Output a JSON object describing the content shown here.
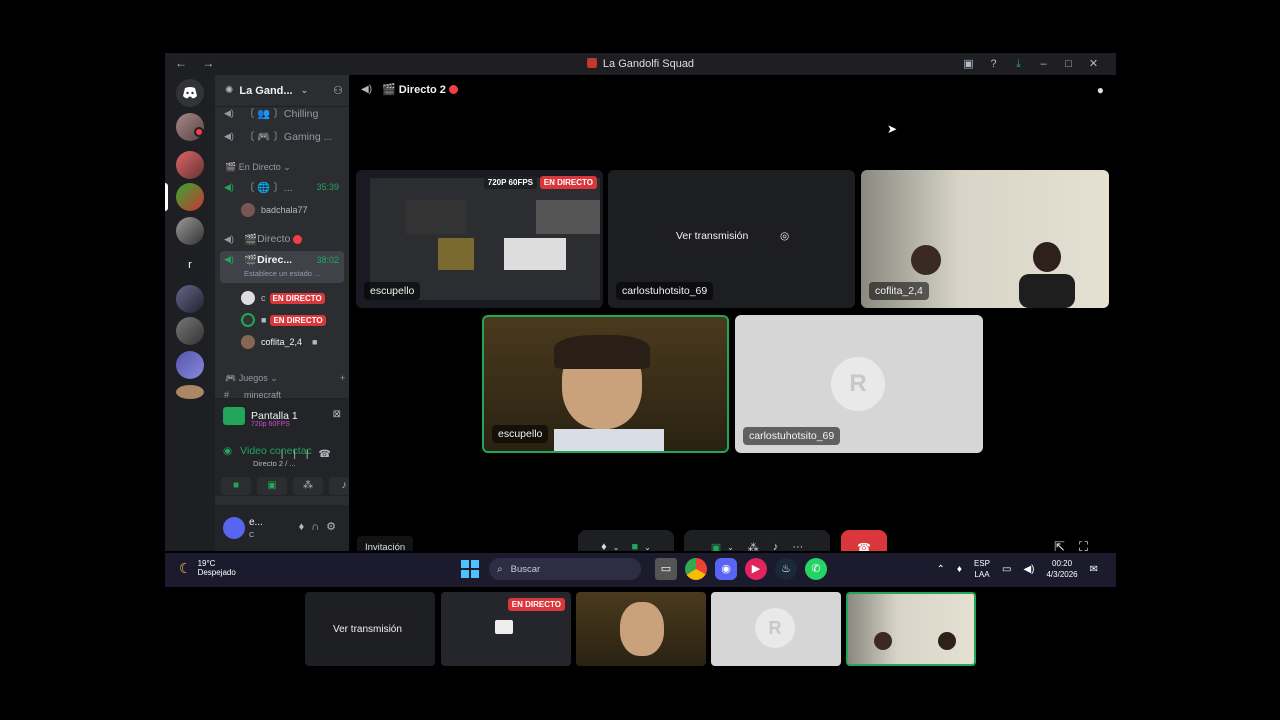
{
  "window": {
    "title": "La Gandolfi Squad"
  },
  "server": {
    "name": "La Gand..."
  },
  "channels": {
    "chilling": "〔 👥 〕Chilling",
    "gaming": "〔 🎮 〕Gaming ...",
    "cat_en_directo": "En Directo",
    "ch_globe": "〔 🌐 〕...",
    "ch_globe_time": "35:39",
    "user_badchala": "badchala77",
    "directo": "Directo",
    "direc2": "Direc...",
    "direc2_time": "38:02",
    "direc2_sub": "Establece un estado ...",
    "user_c": "c",
    "live_label": "EN DIRECTO",
    "user_coflita": "coflita_2,4",
    "cat_juegos": "Juegos",
    "ch_minecraft": "minecraft"
  },
  "stream_panel": {
    "title": "Pantalla 1",
    "quality": "720p 60FPS",
    "voice_status": "Video conectac",
    "voice_channel": "Directo 2 / ..."
  },
  "user_panel": {
    "name": "e...",
    "status": "C"
  },
  "stage": {
    "channel_name": "Directo 2",
    "tiles": {
      "t1_quality": "720P 60FPS",
      "t1_live": "EN DIRECTO",
      "t1_name": "escupello",
      "t2_button": "Ver transmisión",
      "t2_name": "carlostuhotsito_69",
      "t3_name": "coflita_2,4",
      "t4_name": "escupello",
      "t5_name": "carlostuhotsito_69"
    },
    "invite_label": "Invitación"
  },
  "taskbar": {
    "weather_temp": "19°C",
    "weather_desc": "Despejado",
    "search_placeholder": "Buscar",
    "lang1": "ESP",
    "lang2": "LAA",
    "time": "00:20",
    "date": "4/3/2026"
  },
  "thumbnails": {
    "th1_button": "Ver transmisión",
    "th2_live": "EN DIRECTO"
  },
  "colors": {
    "accent_green": "#23a55a",
    "live_red": "#da373c",
    "discord_blurple": "#5865f2"
  }
}
